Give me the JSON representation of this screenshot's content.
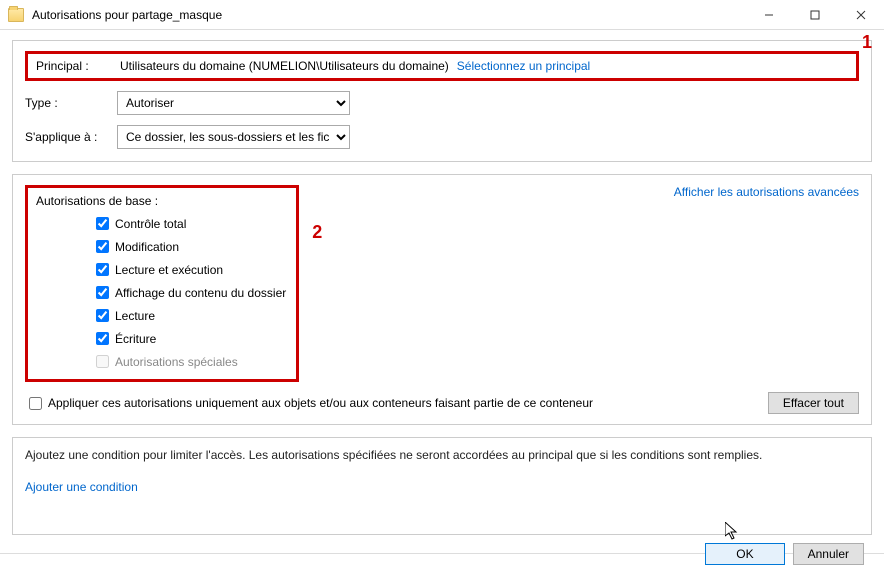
{
  "window": {
    "title": "Autorisations pour partage_masque",
    "min_icon": "minimize-icon",
    "max_icon": "maximize-icon",
    "close_icon": "close-icon"
  },
  "form": {
    "principal_label": "Principal :",
    "principal_value": "Utilisateurs du domaine (NUMELION\\Utilisateurs du domaine)",
    "select_principal_link": "Sélectionnez un principal",
    "type_label": "Type :",
    "type_value": "Autoriser",
    "applies_label": "S'applique à :",
    "applies_value": "Ce dossier, les sous-dossiers et les fichiers"
  },
  "annotations": {
    "one": "1",
    "two": "2"
  },
  "permissions": {
    "basic_label": "Autorisations de base :",
    "advanced_link": "Afficher les autorisations avancées",
    "items": [
      {
        "label": "Contrôle total",
        "checked": true,
        "enabled": true
      },
      {
        "label": "Modification",
        "checked": true,
        "enabled": true
      },
      {
        "label": "Lecture et exécution",
        "checked": true,
        "enabled": true
      },
      {
        "label": "Affichage du contenu du dossier",
        "checked": true,
        "enabled": true
      },
      {
        "label": "Lecture",
        "checked": true,
        "enabled": true
      },
      {
        "label": "Écriture",
        "checked": true,
        "enabled": true
      },
      {
        "label": "Autorisations spéciales",
        "checked": false,
        "enabled": false
      }
    ],
    "apply_only_label": "Appliquer ces autorisations uniquement aux objets et/ou aux conteneurs faisant partie de ce conteneur",
    "clear_all": "Effacer tout"
  },
  "conditions": {
    "intro": "Ajoutez une condition pour limiter l'accès. Les autorisations spécifiées ne seront accordées au principal que si les conditions sont remplies.",
    "add_link": "Ajouter une condition"
  },
  "buttons": {
    "ok": "OK",
    "cancel": "Annuler"
  }
}
